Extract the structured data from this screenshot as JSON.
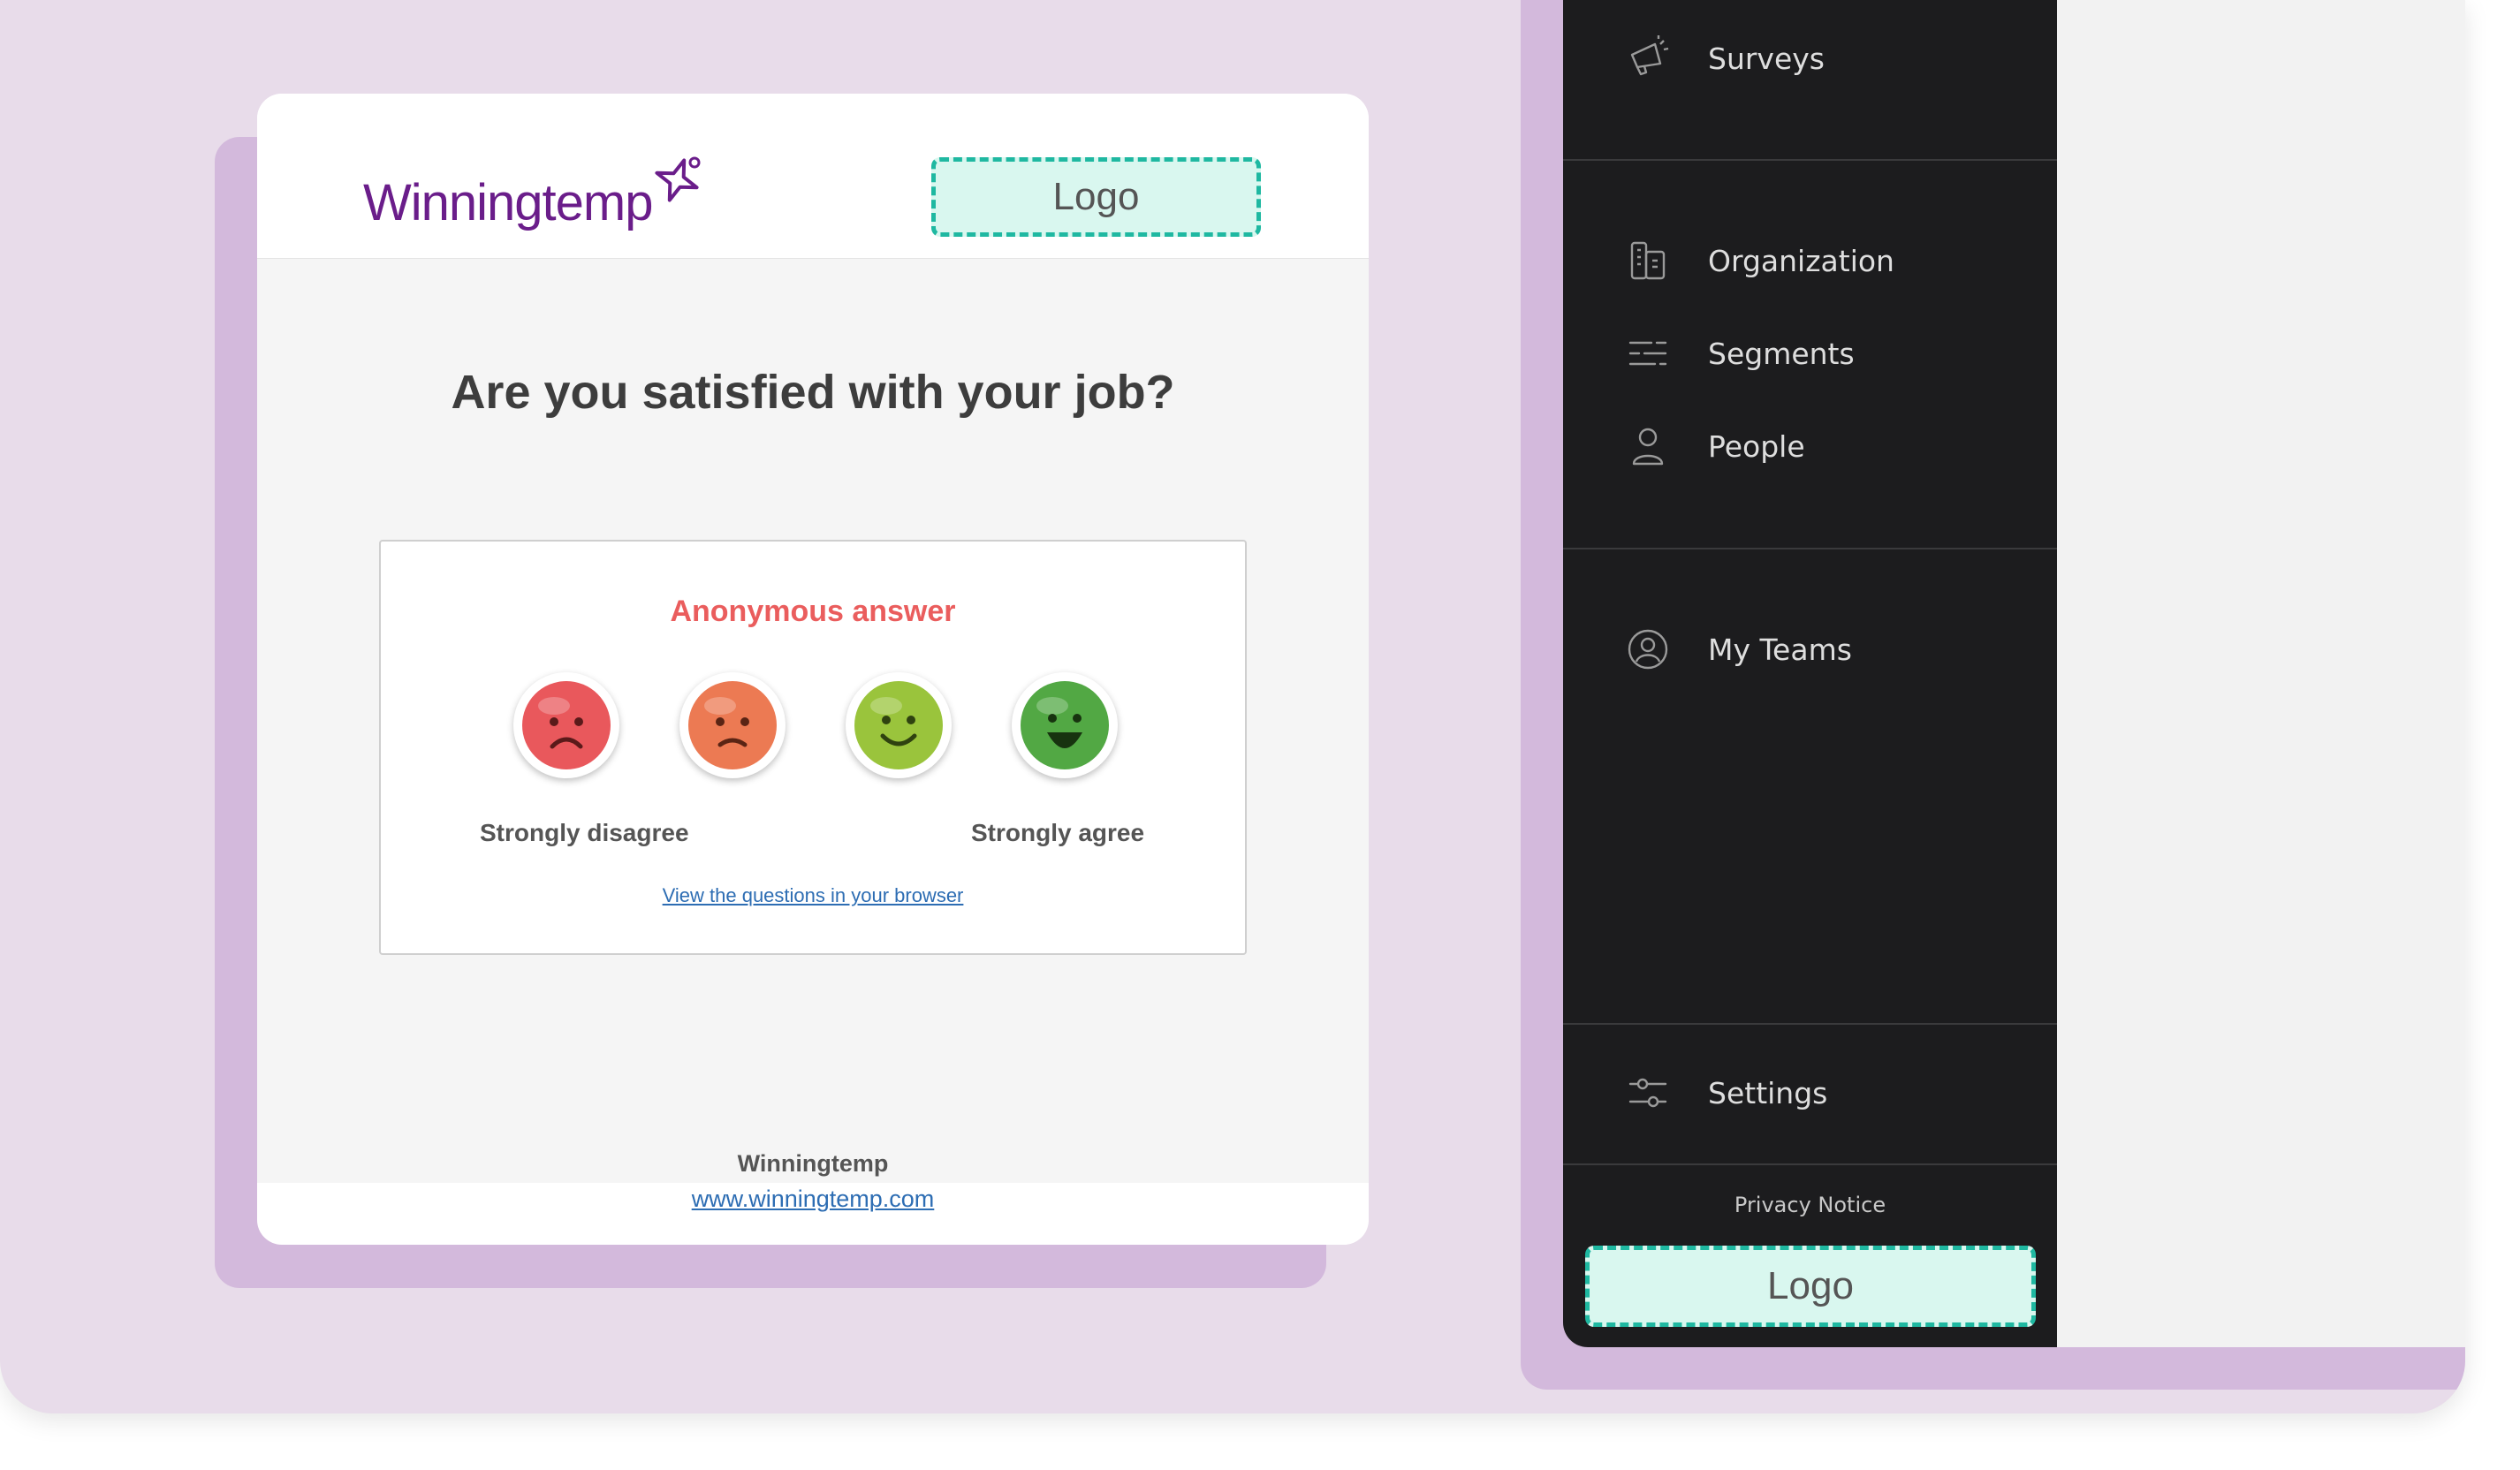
{
  "email": {
    "brand": "Winningtemp",
    "logo_placeholder": "Logo",
    "question": "Are you satisfied with your job?",
    "anonymous_label": "Anonymous answer",
    "scale": [
      {
        "icon": "very-sad-face-icon",
        "color": "#e9585c"
      },
      {
        "icon": "sad-face-icon",
        "color": "#ec7a53"
      },
      {
        "icon": "smile-face-icon",
        "color": "#9ac43c"
      },
      {
        "icon": "laugh-face-icon",
        "color": "#52a844"
      }
    ],
    "scale_min_label": "Strongly disagree",
    "scale_max_label": "Strongly agree",
    "browser_link": "View the questions in your browser",
    "footer_name": "Winningtemp",
    "footer_url": "www.winningtemp.com"
  },
  "sidebar": {
    "groups": [
      {
        "items": [
          {
            "label": "Surveys",
            "icon": "megaphone-icon"
          }
        ]
      },
      {
        "items": [
          {
            "label": "Organization",
            "icon": "organization-icon"
          },
          {
            "label": "Segments",
            "icon": "segments-icon"
          },
          {
            "label": "People",
            "icon": "person-icon"
          }
        ]
      },
      {
        "items": [
          {
            "label": "My Teams",
            "icon": "team-icon"
          }
        ]
      },
      {
        "items": [
          {
            "label": "Settings",
            "icon": "sliders-icon"
          }
        ]
      }
    ],
    "privacy_notice": "Privacy Notice",
    "logo_placeholder": "Logo"
  },
  "colors": {
    "brand_purple": "#6a1d8a",
    "logo_placeholder_fill": "#d9f7ef",
    "logo_placeholder_border": "#1fb8a1",
    "anonymous_red": "#ea5d5d",
    "sidebar_bg": "#1c1c1e"
  }
}
